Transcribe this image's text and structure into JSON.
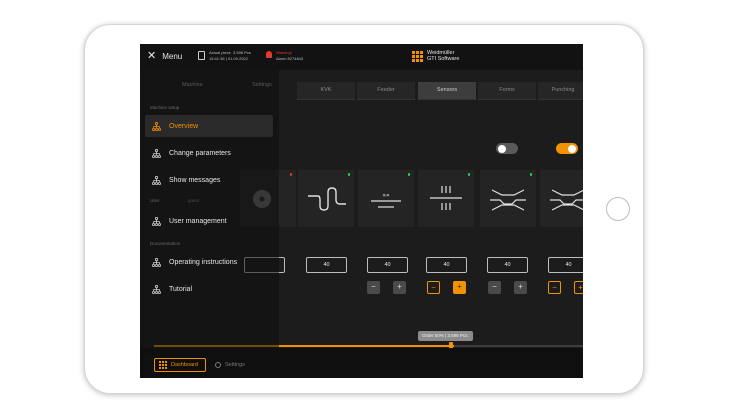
{
  "header": {
    "menu_label": "Menu",
    "piece_label": "Actual piece",
    "piece_count": "3.596 Pcs",
    "piece_time": "15:41:36",
    "piece_date": "01.09.2022",
    "alarm_title": "Warning!",
    "alarm_code": "Alarm 8274843",
    "brand_line1": "Weidmüller",
    "brand_line2": "GTI Software"
  },
  "tabs": [
    "Machine",
    "Settings",
    "KVK",
    "Feeder",
    "Sensors",
    "Forms",
    "Punching"
  ],
  "toggles": [
    {
      "state": "off"
    },
    {
      "state": "on"
    }
  ],
  "stations": [
    {
      "status_color": "#e53935",
      "icon": "roller-icon"
    },
    {
      "status_color": "#2ecc71",
      "icon": "serpentine-icon"
    },
    {
      "status_color": "#2ecc71",
      "icon": "arrow-line-icon"
    },
    {
      "status_color": "#2ecc71",
      "icon": "double-bars-icon"
    },
    {
      "status_color": "#2ecc71",
      "icon": "crimp-icon"
    },
    {
      "status_color": "#2ecc71",
      "icon": "crimp-icon"
    }
  ],
  "inputs": [
    {
      "value": ""
    },
    {
      "value": "40"
    },
    {
      "value": "40"
    },
    {
      "value": "40"
    },
    {
      "value": "40"
    },
    {
      "value": "40"
    }
  ],
  "steppers": [
    {
      "minus": "−",
      "plus": "+",
      "style": "grey"
    },
    {
      "minus": "−",
      "plus": "+",
      "style": "orange"
    },
    {
      "minus": "−",
      "plus": "+",
      "style": "grey"
    },
    {
      "minus": "−",
      "plus": "+",
      "style": "orange"
    }
  ],
  "progress": {
    "fraction": 0.7,
    "tooltip": "Order 50% | 3.596 Pcs."
  },
  "menu": {
    "section_machine": "Machine setup",
    "section_user": "User",
    "section_docs": "Documentation",
    "items": [
      {
        "label": "Overview",
        "active": true
      },
      {
        "label": "Change parameters",
        "active": false
      },
      {
        "label": "Show messages",
        "active": false
      },
      {
        "label": "User management",
        "active": false
      },
      {
        "label": "Operating instructions",
        "active": false
      },
      {
        "label": "Tutorial",
        "active": false
      }
    ],
    "user_chip": "guest"
  },
  "bottom_nav": {
    "dashboard": "Dashboard",
    "settings": "Settings"
  },
  "colors": {
    "accent": "#f39200",
    "error": "#e53935",
    "ok": "#2ecc71",
    "background": "#1c1c1c"
  }
}
